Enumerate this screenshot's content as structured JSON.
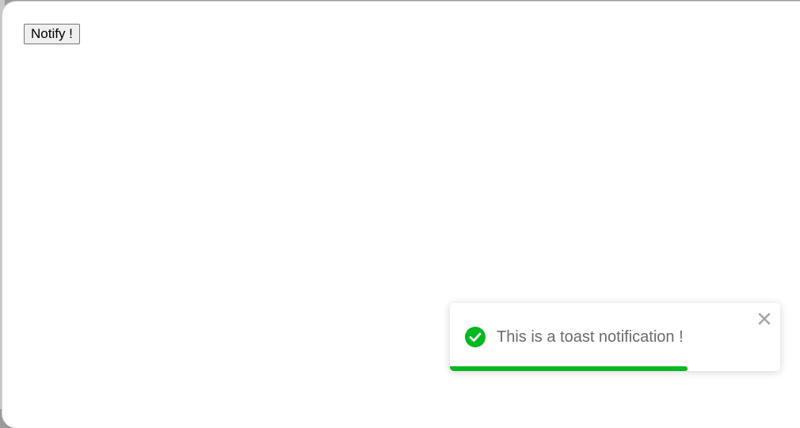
{
  "page": {
    "notify_button_label": "Notify !"
  },
  "toast": {
    "message": "This is a toast notification !",
    "type_icon": "check-circle-icon",
    "close_icon": "close-icon",
    "progress_fraction": 0.72,
    "accent_color": "#00b81f",
    "text_color": "#6b6b6b",
    "close_color": "#a6a6a6"
  }
}
